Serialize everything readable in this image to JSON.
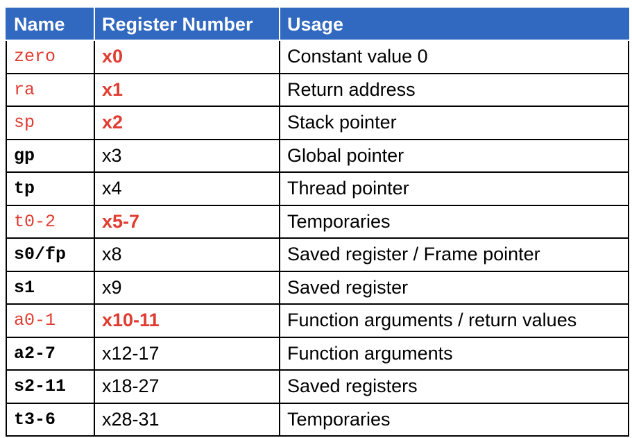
{
  "colors": {
    "header_background": "#3168c0",
    "header_text": "#ffffff",
    "highlight_text": "#e03c31",
    "border": "#000000"
  },
  "table": {
    "headers": [
      "Name",
      "Register Number",
      "Usage"
    ],
    "rows": [
      {
        "name": "zero",
        "number": "x0",
        "usage": "Constant value 0",
        "highlighted": true
      },
      {
        "name": "ra",
        "number": "x1",
        "usage": "Return address",
        "highlighted": true
      },
      {
        "name": "sp",
        "number": "x2",
        "usage": "Stack pointer",
        "highlighted": true
      },
      {
        "name": "gp",
        "number": "x3",
        "usage": "Global pointer",
        "highlighted": false
      },
      {
        "name": "tp",
        "number": "x4",
        "usage": "Thread pointer",
        "highlighted": false
      },
      {
        "name": "t0-2",
        "number": "x5-7",
        "usage": "Temporaries",
        "highlighted": true
      },
      {
        "name": "s0/fp",
        "number": "x8",
        "usage": "Saved register / Frame pointer",
        "highlighted": false
      },
      {
        "name": "s1",
        "number": "x9",
        "usage": "Saved register",
        "highlighted": false
      },
      {
        "name": "a0-1",
        "number": "x10-11",
        "usage": "Function arguments / return values",
        "highlighted": true
      },
      {
        "name": "a2-7",
        "number": "x12-17",
        "usage": "Function arguments",
        "highlighted": false
      },
      {
        "name": "s2-11",
        "number": "x18-27",
        "usage": "Saved registers",
        "highlighted": false
      },
      {
        "name": "t3-6",
        "number": "x28-31",
        "usage": "Temporaries",
        "highlighted": false
      }
    ]
  }
}
